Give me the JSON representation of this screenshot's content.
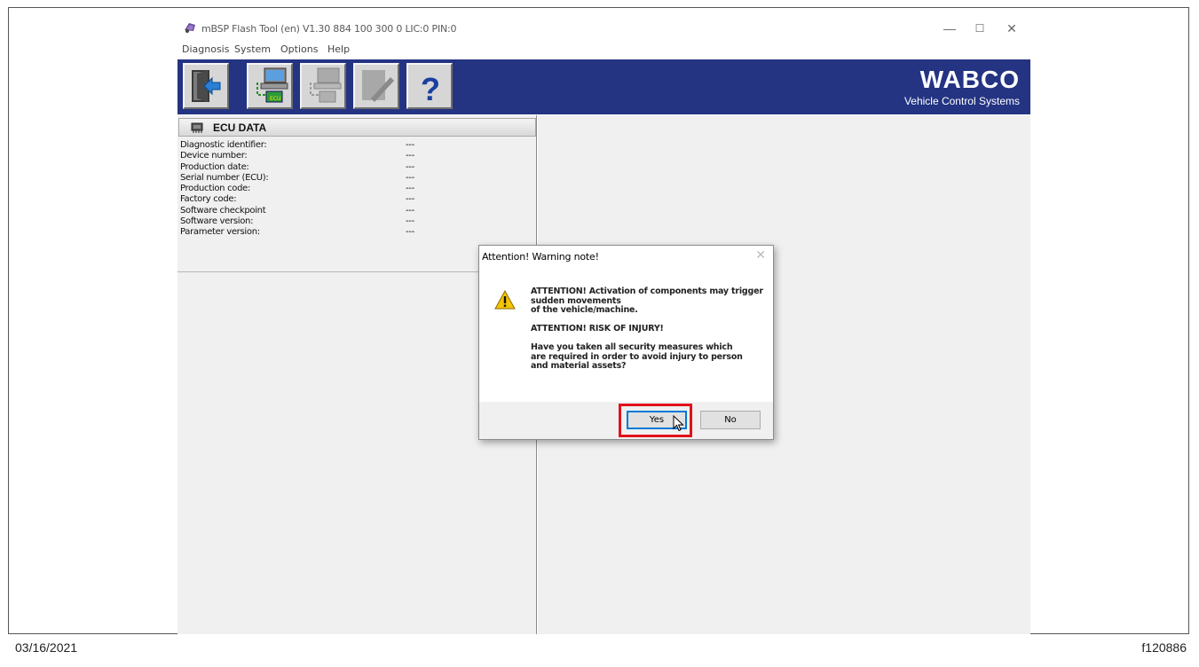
{
  "window": {
    "title": "mBSP Flash Tool (en) V1.30  884 100 300 0  LIC:0 PIN:0",
    "controls": {
      "minimize": "—",
      "maximize": "☐",
      "close": "✕"
    }
  },
  "menu": [
    "Diagnosis",
    "System",
    "Options",
    "Help"
  ],
  "toolbar": {
    "buttons": [
      "exit-icon",
      "ecu-connect-icon",
      "flash-icon",
      "edit-icon",
      "help-icon"
    ],
    "help_glyph": "?"
  },
  "brand": {
    "logo": "WABCO",
    "tagline": "Vehicle Control Systems",
    "color": "#243483"
  },
  "ecu_panel": {
    "title": "ECU DATA",
    "rows": [
      {
        "label": "Diagnostic identifier:",
        "value": "---"
      },
      {
        "label": "Device number:",
        "value": "---"
      },
      {
        "label": "Production date:",
        "value": "---"
      },
      {
        "label": "Serial number (ECU):",
        "value": "---"
      },
      {
        "label": "Production code:",
        "value": "---"
      },
      {
        "label": "Factory code:",
        "value": "---"
      },
      {
        "label": "Software checkpoint",
        "value": "---"
      },
      {
        "label": "Software version:",
        "value": "---"
      },
      {
        "label": "Parameter version:",
        "value": "---"
      }
    ]
  },
  "dialog": {
    "title": "Attention! Warning note!",
    "close": "✕",
    "message_lines": [
      "ATTENTION! Activation of components may trigger",
      "sudden movements",
      "of the vehicle/machine.",
      "",
      "ATTENTION! RISK OF INJURY!",
      "",
      "Have you taken all security measures which",
      "are required in order to avoid injury to person",
      "and material assets?"
    ],
    "yes_label": "Yes",
    "no_label": "No",
    "highlight_color": "#e0121c"
  },
  "footer": {
    "date": "03/16/2021",
    "figure_id": "f120886"
  }
}
